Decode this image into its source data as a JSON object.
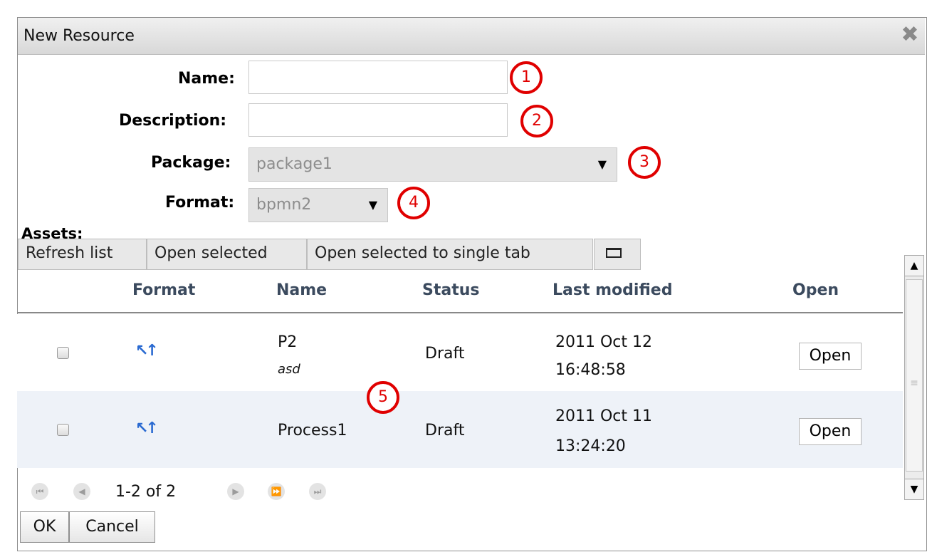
{
  "dialog": {
    "title": "New Resource",
    "close_icon": "close-icon"
  },
  "form": {
    "name_label": "Name:",
    "name_value": "",
    "description_label": "Description:",
    "description_value": "",
    "package_label": "Package:",
    "package_value": "package1",
    "format_label": "Format:",
    "format_value": "bpmn2"
  },
  "callouts": [
    "1",
    "2",
    "3",
    "4",
    "5"
  ],
  "assets": {
    "label": "Assets:",
    "toolbar": [
      "Refresh list",
      "Open selected",
      "Open selected to single tab"
    ],
    "columns": [
      "Format",
      "Name",
      "Status",
      "Last modified",
      "Open"
    ],
    "rows": [
      {
        "name": "P2",
        "description": "asd",
        "status": "Draft",
        "date": "2011 Oct 12",
        "time": "16:48:58",
        "open": "Open"
      },
      {
        "name": "Process1",
        "description": "",
        "status": "Draft",
        "date": "2011 Oct 11",
        "time": "13:24:20",
        "open": "Open"
      }
    ],
    "pager": "1-2 of 2"
  },
  "buttons": {
    "ok": "OK",
    "cancel": "Cancel"
  }
}
